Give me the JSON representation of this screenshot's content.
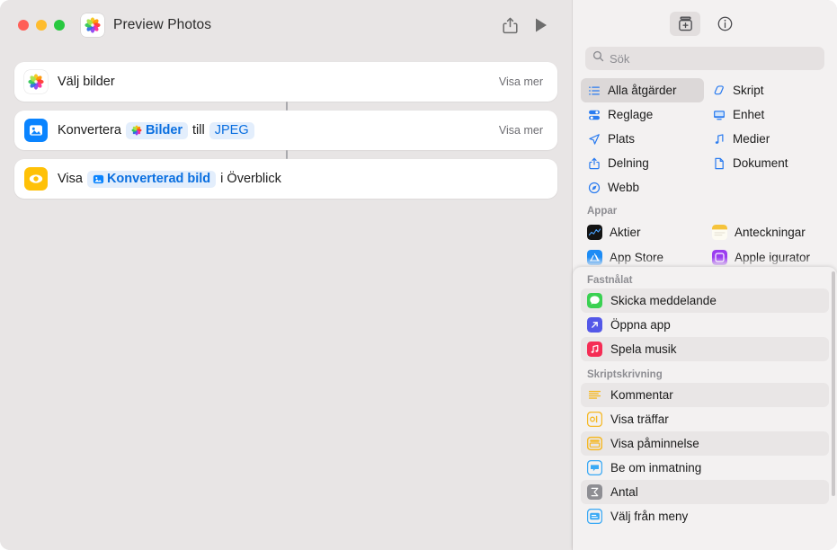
{
  "window": {
    "title": "Preview Photos",
    "app_icon": "photos-icon",
    "traffic_lights": [
      "close-button",
      "minimize-button",
      "zoom-button"
    ],
    "share_label": "share-icon",
    "run_label": "run-icon"
  },
  "editor": {
    "actions": [
      {
        "icon": "photos-icon",
        "prefix": "Välj bilder",
        "tokens": [],
        "suffix": "",
        "show_more": "Visa mer"
      },
      {
        "icon": "convert-image-icon",
        "prefix": "Konvertera",
        "tokens": [
          {
            "label": "Bilder",
            "icon": "photos-token-icon"
          },
          {
            "label": "JPEG",
            "icon": ""
          }
        ],
        "mid": "till",
        "suffix": "",
        "show_more": "Visa mer"
      },
      {
        "icon": "quick-look-icon",
        "prefix": "Visa",
        "tokens": [
          {
            "label": "Konverterad bild",
            "icon": "converted-image-token-icon"
          }
        ],
        "suffix": "i Överblick",
        "show_more": ""
      }
    ]
  },
  "library": {
    "toolbar": {
      "action_library_button": "action-library-icon",
      "info_button": "info-icon"
    },
    "search": {
      "placeholder": "Sök",
      "value": "",
      "icon": "search-icon"
    },
    "categories": [
      {
        "label": "Alla åtgärder",
        "icon": "list-icon",
        "selected": true
      },
      {
        "label": "Skript",
        "icon": "script-icon",
        "selected": false
      },
      {
        "label": "Reglage",
        "icon": "controls-icon",
        "selected": false
      },
      {
        "label": "Enhet",
        "icon": "device-icon",
        "selected": false
      },
      {
        "label": "Plats",
        "icon": "location-icon",
        "selected": false
      },
      {
        "label": "Medier",
        "icon": "media-icon",
        "selected": false
      },
      {
        "label": "Delning",
        "icon": "share-icon",
        "selected": false
      },
      {
        "label": "Dokument",
        "icon": "document-icon",
        "selected": false
      },
      {
        "label": "Webb",
        "icon": "web-icon",
        "selected": false
      }
    ],
    "apps_section_title": "Appar",
    "apps": [
      {
        "label": "Aktier",
        "icon": "stocks-app-icon"
      },
      {
        "label": "Anteckningar",
        "icon": "notes-app-icon"
      },
      {
        "label": "App Store",
        "icon": "app-store-app-icon"
      },
      {
        "label": "Apple  igurator",
        "icon": "apple-configurator-app-icon"
      }
    ],
    "overlay": {
      "pinned_title": "Fastnålat",
      "pinned": [
        {
          "label": "Skicka meddelande",
          "icon": "messages-icon",
          "striped": true
        },
        {
          "label": "Öppna app",
          "icon": "open-app-icon",
          "striped": false
        },
        {
          "label": "Spela musik",
          "icon": "music-icon",
          "striped": true
        }
      ],
      "scripting_title": "Skriptskrivning",
      "scripting": [
        {
          "label": "Kommentar",
          "icon": "comment-icon",
          "striped": true
        },
        {
          "label": "Visa träffar",
          "icon": "show-result-icon",
          "striped": false
        },
        {
          "label": "Visa påminnelse",
          "icon": "show-alert-icon",
          "striped": true
        },
        {
          "label": "Be om inmatning",
          "icon": "ask-for-input-icon",
          "striped": false
        },
        {
          "label": "Antal",
          "icon": "count-icon",
          "striped": true
        },
        {
          "label": "Välj från meny",
          "icon": "choose-from-menu-icon",
          "striped": false
        }
      ]
    }
  },
  "colors": {
    "accent_blue": "#0a84ff",
    "token_blue": "#0a6fe0",
    "window_bg": "#e8e5e5",
    "library_bg": "#f3f1f1",
    "yellow": "#ffc107"
  }
}
